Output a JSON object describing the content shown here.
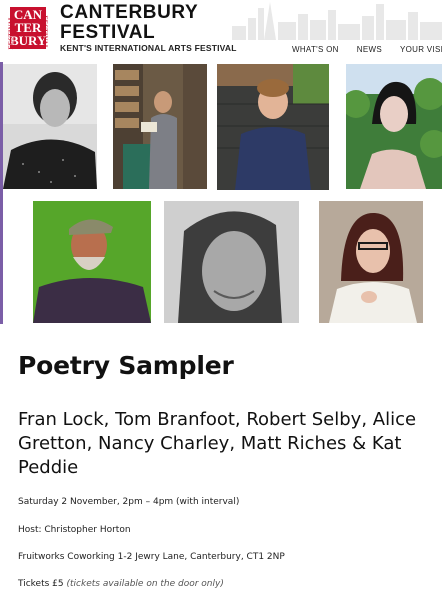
{
  "brand": {
    "logo_lines": [
      "CAN",
      "TER",
      "BURY"
    ],
    "logo_side": "FESTIVAL",
    "title_line1": "CANTERBURY",
    "title_line2": "FESTIVAL",
    "subtitle": "KENT'S INTERNATIONAL ARTS FESTIVAL",
    "accent_color": "#c8102e"
  },
  "nav": {
    "items": [
      "WHAT'S ON",
      "NEWS",
      "YOUR VISIT"
    ]
  },
  "photos": [
    {
      "icon": "portrait-photo"
    },
    {
      "icon": "portrait-photo"
    },
    {
      "icon": "portrait-photo"
    },
    {
      "icon": "portrait-photo"
    },
    {
      "icon": "portrait-photo"
    },
    {
      "icon": "portrait-photo"
    },
    {
      "icon": "portrait-photo"
    }
  ],
  "event": {
    "title": "Poetry Sampler",
    "poets": "Fran Lock, Tom Branfoot, Robert Selby, Alice Gretton, Nancy Charley, Matt Riches & Kat Peddie",
    "date": "Saturday 2 November, 2pm – 4pm (with interval)",
    "host": "Host: Christopher Horton",
    "venue": "Fruitworks Coworking 1-2 Jewry Lane, Canterbury, CT1 2NP",
    "tickets_label": "Tickets £5",
    "tickets_note": "(tickets available on the door only)"
  },
  "colors": {
    "side_accent": "#7b5ea7"
  }
}
